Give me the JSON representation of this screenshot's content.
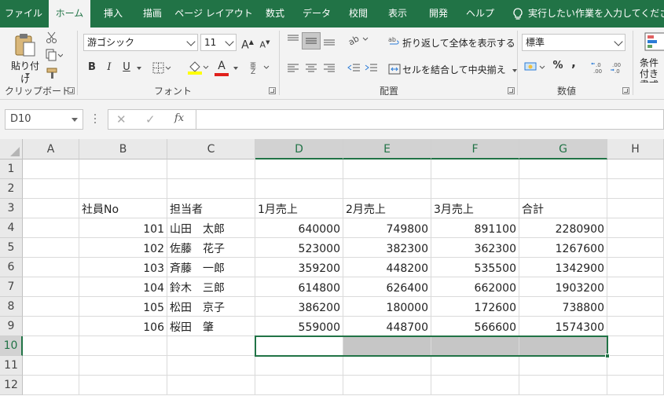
{
  "tabs": [
    {
      "label": "ファイル",
      "active": false
    },
    {
      "label": "ホーム",
      "active": true
    },
    {
      "label": "挿入",
      "active": false
    },
    {
      "label": "描画",
      "active": false
    },
    {
      "label": "ページ レイアウト",
      "active": false
    },
    {
      "label": "数式",
      "active": false
    },
    {
      "label": "データ",
      "active": false
    },
    {
      "label": "校閲",
      "active": false
    },
    {
      "label": "表示",
      "active": false
    },
    {
      "label": "開発",
      "active": false
    },
    {
      "label": "ヘルプ",
      "active": false
    }
  ],
  "tell_me": "実行したい作業を入力してください",
  "ribbon": {
    "clipboard": {
      "paste_label": "貼り付け",
      "group_label": "クリップボード"
    },
    "font": {
      "font_name": "游ゴシック",
      "font_size": "11",
      "bold": "B",
      "italic": "I",
      "underline": "U",
      "font_color_glyph": "A",
      "grow": "A",
      "shrink": "A",
      "group_label": "フォント"
    },
    "alignment": {
      "wrap_text": "折り返して全体を表示する",
      "merge_center": "セルを結合して中央揃え",
      "group_label": "配置"
    },
    "number": {
      "format": "標準",
      "percent": "%",
      "comma": ",",
      "inc_decimal": "←.0\n.00",
      "group_label": "数値"
    },
    "styles": {
      "cond_format": "条件付き書式"
    }
  },
  "formula_bar": {
    "name_box": "D10",
    "cancel": "✕",
    "enter": "✓",
    "fx": "fx",
    "value": ""
  },
  "colors": {
    "accent": "#217346",
    "header_bg": "#e9e9e9",
    "selected_fill": "#c6c6c6"
  },
  "sheet": {
    "columns": [
      "A",
      "B",
      "C",
      "D",
      "E",
      "F",
      "G",
      "H"
    ],
    "rows": [
      "1",
      "2",
      "3",
      "4",
      "5",
      "6",
      "7",
      "8",
      "9",
      "10",
      "11",
      "12"
    ],
    "headers": [
      "社員No",
      "担当者",
      "1月売上",
      "2月売上",
      "3月売上",
      "合計"
    ],
    "data": [
      [
        "101",
        "山田　太郎",
        "640000",
        "749800",
        "891100",
        "2280900"
      ],
      [
        "102",
        "佐藤　花子",
        "523000",
        "382300",
        "362300",
        "1267600"
      ],
      [
        "103",
        "斉藤　一郎",
        "359200",
        "448200",
        "535500",
        "1342900"
      ],
      [
        "104",
        "鈴木　三郎",
        "614800",
        "626400",
        "662000",
        "1903200"
      ],
      [
        "105",
        "松田　京子",
        "386200",
        "180000",
        "172600",
        "738800"
      ],
      [
        "106",
        "桜田　肇",
        "559000",
        "448700",
        "566600",
        "1574300"
      ]
    ],
    "active_cell": "D10",
    "selection": "D10:G10"
  }
}
